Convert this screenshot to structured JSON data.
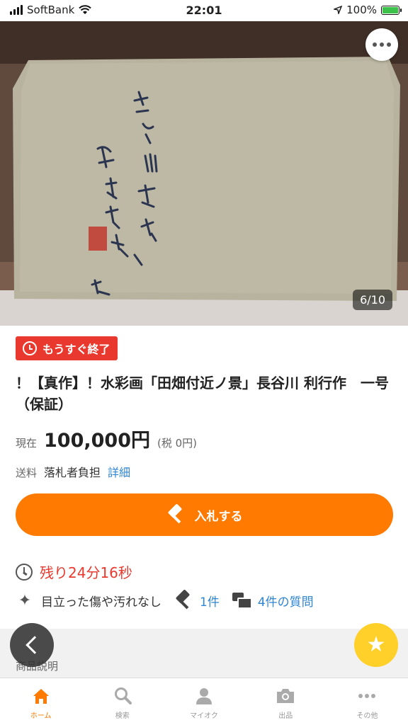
{
  "status_bar": {
    "carrier": "SoftBank",
    "time": "22:01",
    "battery": "100%"
  },
  "hero": {
    "counter": "6/10"
  },
  "badge": {
    "label": "もうすぐ終了"
  },
  "item": {
    "title": "！【真作】！水彩画「田畑付近ノ景」長谷川 利行作　一号（保証）",
    "price_label": "現在",
    "price": "100,000円",
    "tax": "(税 0円)",
    "shipping_label": "送料",
    "shipping_value": "落札者負担",
    "shipping_link": "詳細"
  },
  "actions": {
    "bid_label": "入札する"
  },
  "stats": {
    "remaining": "残り24分16秒",
    "condition": "目立った傷や汚れなし",
    "bids": "1件",
    "questions": "4件の質問"
  },
  "section": {
    "label": "商品説明"
  },
  "tabs": [
    {
      "label": "ホーム",
      "icon": "home-icon",
      "active": true
    },
    {
      "label": "検索",
      "icon": "search-icon",
      "active": false
    },
    {
      "label": "マイオク",
      "icon": "person-icon",
      "active": false
    },
    {
      "label": "出品",
      "icon": "camera-icon",
      "active": false
    },
    {
      "label": "その他",
      "icon": "more-icon",
      "active": false
    }
  ],
  "colors": {
    "accent": "#ff7a00",
    "alert": "#e9392e",
    "link": "#2f86d4",
    "favorite": "#ffcf2a"
  }
}
